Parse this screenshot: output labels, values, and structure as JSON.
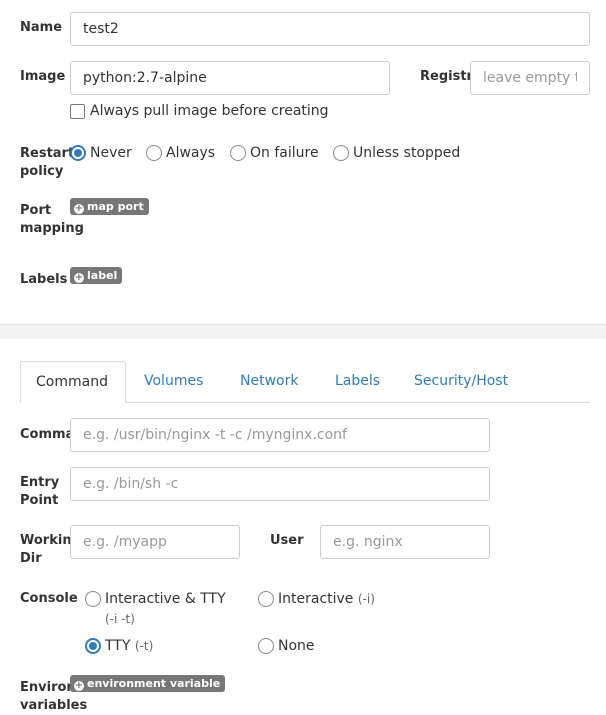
{
  "form": {
    "name": {
      "label": "Name",
      "value": "test2"
    },
    "image": {
      "label": "Image",
      "value": "python:2.7-alpine"
    },
    "registry": {
      "label": "Registry",
      "placeholder": "leave empty to use DockerHub"
    },
    "always_pull": {
      "label": "Always pull image before creating",
      "checked": false
    },
    "restart_policy": {
      "label_line1": "Restart",
      "label_line2": "policy",
      "options": [
        "Never",
        "Always",
        "On failure",
        "Unless stopped"
      ],
      "selected": "Never"
    },
    "port_mapping": {
      "label_line1": "Port",
      "label_line2": "mapping",
      "button": "map port"
    },
    "labels": {
      "label": "Labels",
      "button": "label"
    }
  },
  "tabs": {
    "items": [
      "Command",
      "Volumes",
      "Network",
      "Labels",
      "Security/Host"
    ],
    "active": "Command"
  },
  "command_tab": {
    "command": {
      "label": "Command",
      "placeholder": "e.g. /usr/bin/nginx -t -c /mynginx.conf"
    },
    "entry_point": {
      "label_line1": "Entry",
      "label_line2": "Point",
      "placeholder": "e.g. /bin/sh -c"
    },
    "working_dir": {
      "label_line1": "Working",
      "label_line2": "Dir",
      "placeholder": "e.g. /myapp"
    },
    "user": {
      "label": "User",
      "placeholder": "e.g. nginx"
    },
    "console": {
      "label": "Console",
      "options": [
        {
          "label": "Interactive & TTY",
          "hint": "(-i -t)"
        },
        {
          "label": "Interactive",
          "hint": "(-i)"
        },
        {
          "label": "TTY",
          "hint": "(-t)"
        },
        {
          "label": "None",
          "hint": ""
        }
      ],
      "selected": "TTY"
    },
    "env": {
      "label_line1": "Environment",
      "label_line2": "variables",
      "button": "environment variable"
    }
  },
  "colors": {
    "accent": "#337ab7",
    "badge": "#777777",
    "divider": "#f4f4f4"
  }
}
